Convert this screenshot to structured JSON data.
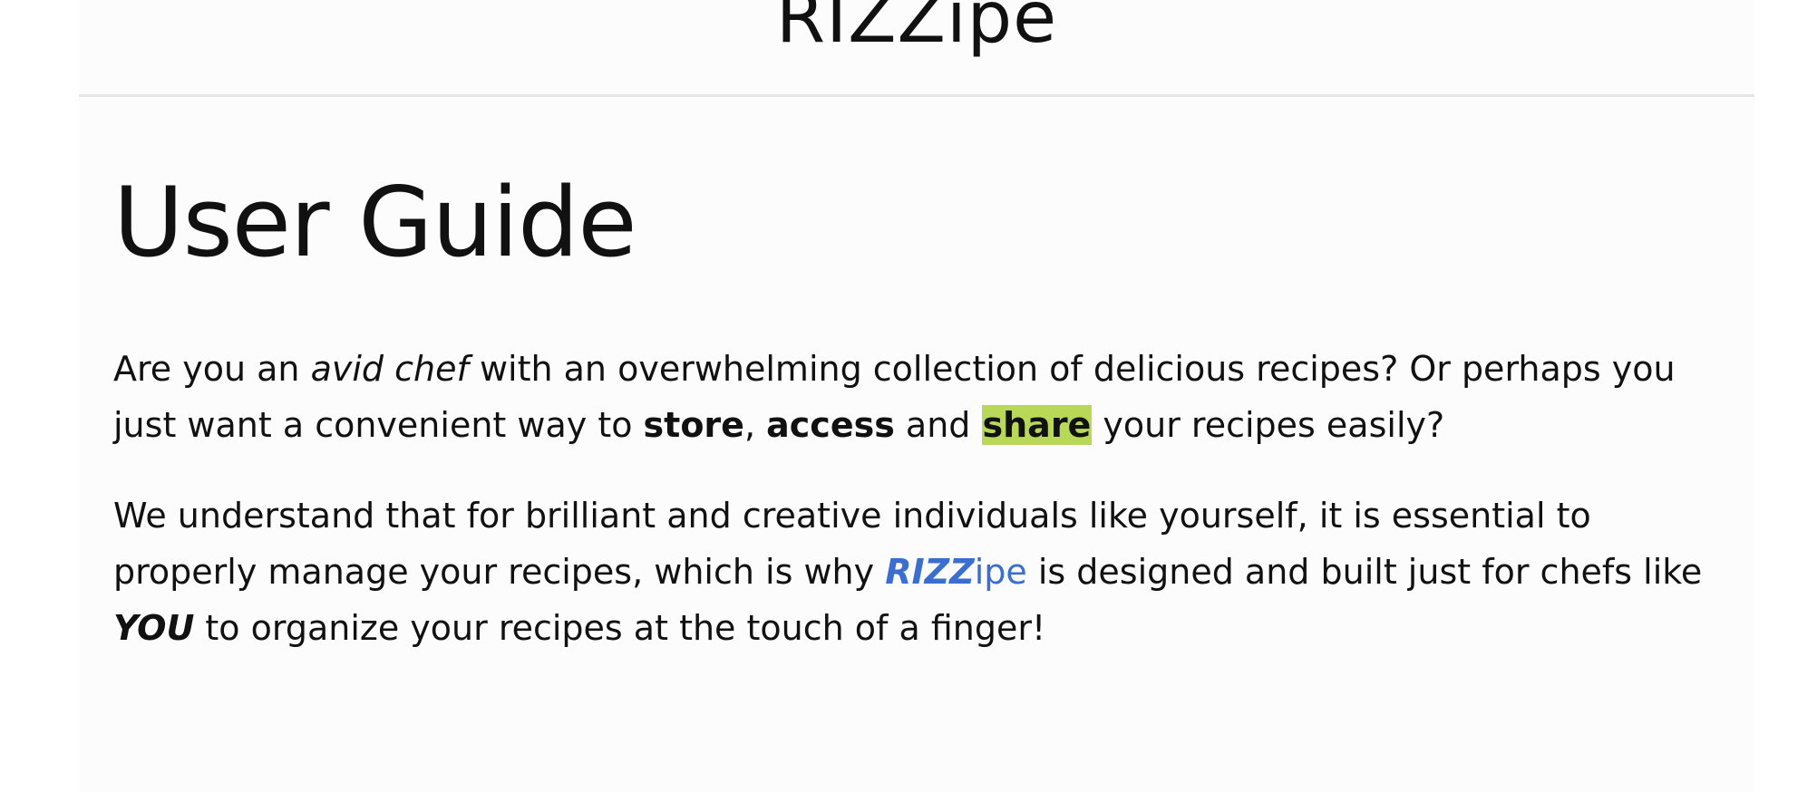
{
  "header": {
    "site_title": "RIZZipe"
  },
  "main": {
    "title": "User Guide",
    "paragraph1": {
      "part1": "Are you an ",
      "emphasis": "avid chef",
      "part2": " with an overwhelming collection of delicious recipes? Or perhaps you just want a convenient way to ",
      "store": "store",
      "comma": ",",
      "space1": " ",
      "access": "access",
      "and": " and ",
      "share": "share",
      "end": " your recipes easily?"
    },
    "paragraph2": {
      "part1": "We understand that for brilliant and creative individuals like yourself, it is essential to properly manage your recipes, which is why ",
      "brand_bold": "RIZZ",
      "brand_rest": "ipe",
      "part2": " is designed and built just for chefs like ",
      "you": "YOU",
      "part3": " to organize your recipes at the touch of a finger!"
    }
  },
  "colors": {
    "highlight": "#b9d857",
    "brand": "#3a6fd1"
  }
}
